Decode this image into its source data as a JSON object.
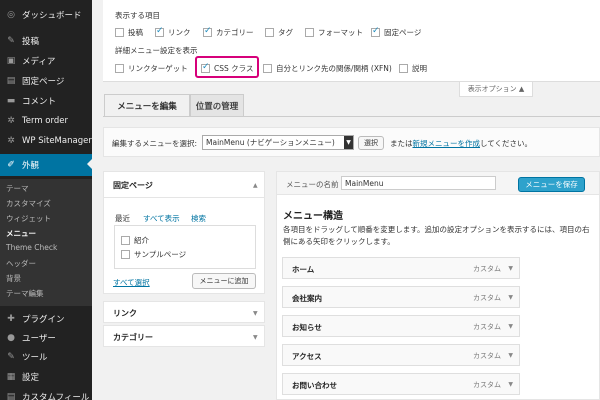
{
  "sidebar": {
    "items": [
      {
        "label": "ダッシュボード",
        "icon": "dashboard-icon",
        "glyph": "◎"
      },
      {
        "label": "投稿",
        "icon": "pin-icon",
        "glyph": "✎"
      },
      {
        "label": "メディア",
        "icon": "media-icon",
        "glyph": "▣"
      },
      {
        "label": "固定ページ",
        "icon": "page-icon",
        "glyph": "▤"
      },
      {
        "label": "コメント",
        "icon": "comment-icon",
        "glyph": "▬"
      },
      {
        "label": "Term order",
        "icon": "gear-icon",
        "glyph": "✲"
      },
      {
        "label": "WP SiteManager",
        "icon": "gear-icon",
        "glyph": "✲"
      },
      {
        "label": "外観",
        "icon": "brush-icon",
        "glyph": "✐"
      }
    ],
    "submenu": [
      "テーマ",
      "カスタマイズ",
      "ウィジェット",
      "メニュー",
      "Theme Check",
      "ヘッダー",
      "背景",
      "テーマ編集"
    ],
    "bottom": [
      {
        "label": "プラグイン",
        "icon": "plugin-icon",
        "glyph": "✚"
      },
      {
        "label": "ユーザー",
        "icon": "user-icon",
        "glyph": "●"
      },
      {
        "label": "ツール",
        "icon": "wrench-icon",
        "glyph": "✎"
      },
      {
        "label": "設定",
        "icon": "settings-icon",
        "glyph": "▦"
      },
      {
        "label": "カスタムフィール",
        "icon": "custom-field-icon",
        "glyph": "▤"
      }
    ]
  },
  "screen_options": {
    "heading1": "表示する項目",
    "boxes": [
      {
        "label": "投稿",
        "checked": false
      },
      {
        "label": "リンク",
        "checked": true
      },
      {
        "label": "カテゴリー",
        "checked": true
      },
      {
        "label": "タグ",
        "checked": false
      },
      {
        "label": "フォーマット",
        "checked": false
      },
      {
        "label": "固定ページ",
        "checked": true
      }
    ],
    "heading2": "詳細メニュー設定を表示",
    "advanced": [
      {
        "label": "リンクターゲット",
        "checked": false
      },
      {
        "label": "CSS クラス",
        "checked": true
      },
      {
        "label": "自分とリンク先の関係/関柄 (XFN)",
        "checked": false
      },
      {
        "label": "説明",
        "checked": false
      }
    ],
    "tab_label": "表示オプション ▲"
  },
  "nav_tabs": {
    "edit": "メニューを編集",
    "locations": "位置の管理"
  },
  "manage": {
    "label": "編集するメニューを選択:",
    "selected": "MainMenu (ナビゲーションメニュー)",
    "select_btn": "選択",
    "after_pre": "または",
    "create_link": "新規メニューを作成",
    "after_post": "してください。"
  },
  "pages_box": {
    "title": "固定ページ",
    "tabs": [
      "最近",
      "すべて表示",
      "検索"
    ],
    "items": [
      "紹介",
      "サンプルページ"
    ],
    "select_all": "すべて選択",
    "add_btn": "メニューに追加"
  },
  "links_box": {
    "title": "リンク"
  },
  "categories_box": {
    "title": "カテゴリー"
  },
  "menu_header": {
    "name_label": "メニューの名前",
    "name_value": "MainMenu",
    "save_btn": "メニューを保存"
  },
  "structure": {
    "title": "メニュー構造",
    "description": "各項目をドラッグして順番を変更します。追加の設定オプションを表示するには、項目の右側にある矢印をクリックします。",
    "items": [
      {
        "title": "ホーム",
        "type": "カスタム"
      },
      {
        "title": "会社案内",
        "type": "カスタム"
      },
      {
        "title": "お知らせ",
        "type": "カスタム"
      },
      {
        "title": "アクセス",
        "type": "カスタム"
      },
      {
        "title": "お問い合わせ",
        "type": "カスタム"
      }
    ]
  },
  "colors": {
    "sidebar": "#222222",
    "active": "#0074a2",
    "highlight": "#d6007a",
    "save": "#2ea2cc"
  }
}
